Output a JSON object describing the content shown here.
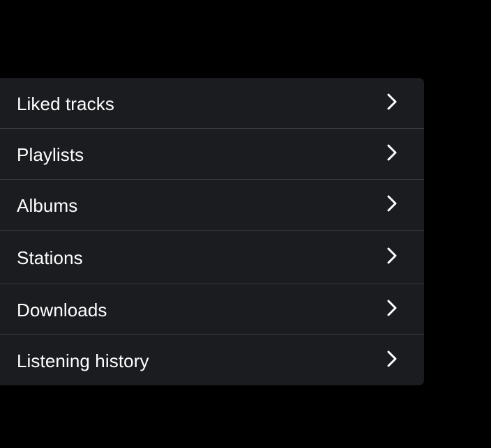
{
  "colors": {
    "background": "#000000",
    "card": "#1b1c20",
    "divider": "#3a3b40",
    "text": "#ffffff"
  },
  "menu": {
    "items": [
      {
        "label": "Liked tracks",
        "icon": "chevron-right-icon"
      },
      {
        "label": "Playlists",
        "icon": "chevron-right-icon"
      },
      {
        "label": "Albums",
        "icon": "chevron-right-icon"
      },
      {
        "label": "Stations",
        "icon": "chevron-right-icon"
      },
      {
        "label": "Downloads",
        "icon": "chevron-right-icon"
      },
      {
        "label": "Listening history",
        "icon": "chevron-right-icon"
      }
    ]
  }
}
